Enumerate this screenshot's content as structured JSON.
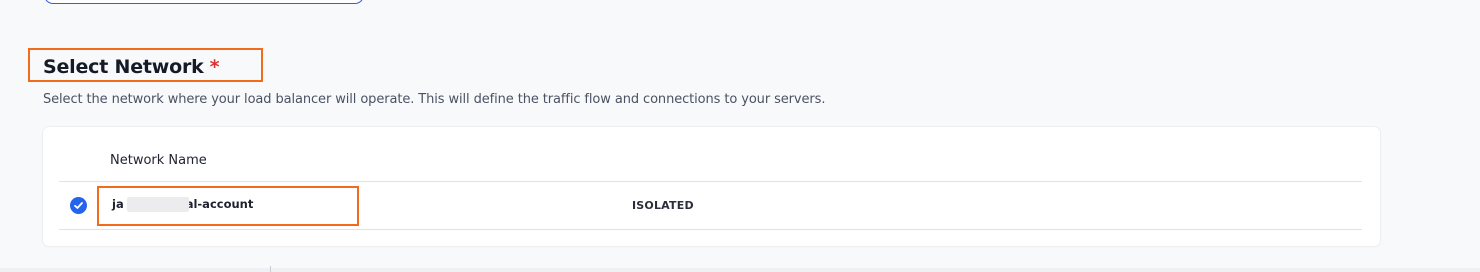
{
  "section": {
    "title": "Select Network",
    "required_mark": "*",
    "description": "Select the network where your load balancer will operate. This will define the traffic flow and connections to your servers."
  },
  "table": {
    "columns": [
      "Network Name"
    ],
    "rows": [
      {
        "selected": true,
        "name_prefix": "ja",
        "name_suffix": "al-account",
        "type": "ISOLATED"
      }
    ]
  },
  "colors": {
    "accent": "#2563eb",
    "highlight_border": "#f26b1d",
    "required": "#e03131"
  },
  "icons": {
    "selected_radio": "check-circle-icon"
  }
}
